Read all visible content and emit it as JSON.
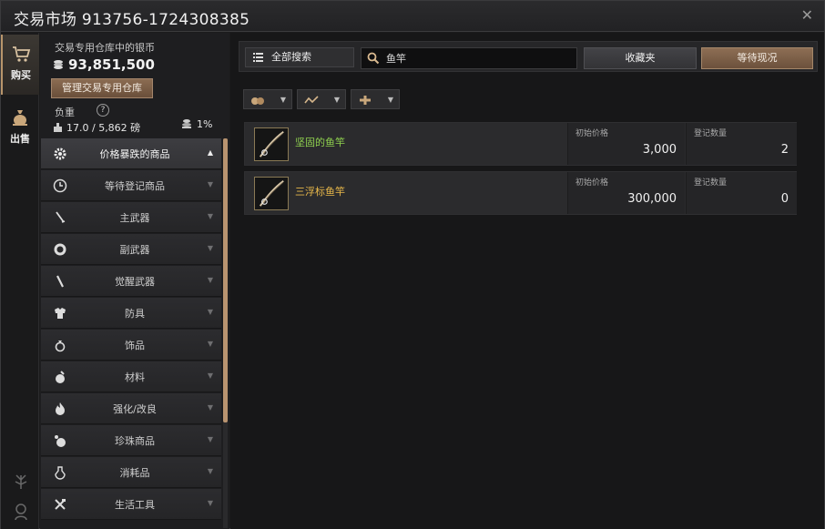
{
  "window": {
    "title": "交易市场 913756-1724308385"
  },
  "nav": {
    "buy_label": "购买",
    "sell_label": "出售"
  },
  "wallet": {
    "label": "交易专用仓库中的银币",
    "silver": "93,851,500",
    "manage_button": "管理交易专用仓库",
    "weight_label": "负重",
    "help": "?",
    "weight_value": "17.0 / 5,862 磅",
    "tax": "1%"
  },
  "categories": [
    {
      "label": "价格暴跌的商品",
      "icon": "gear-icon",
      "arrow": "▲",
      "active": true
    },
    {
      "label": "等待登记商品",
      "icon": "clock-icon",
      "arrow": "▼"
    },
    {
      "label": "主武器",
      "icon": "sword-icon",
      "arrow": "▼"
    },
    {
      "label": "副武器",
      "icon": "shield-icon",
      "arrow": "▼"
    },
    {
      "label": "觉醒武器",
      "icon": "awakening-sword-icon",
      "arrow": "▼"
    },
    {
      "label": "防具",
      "icon": "armor-icon",
      "arrow": "▼"
    },
    {
      "label": "饰品",
      "icon": "ring-icon",
      "arrow": "▼"
    },
    {
      "label": "材料",
      "icon": "material-icon",
      "arrow": "▼"
    },
    {
      "label": "强化/改良",
      "icon": "flame-icon",
      "arrow": "▼"
    },
    {
      "label": "珍珠商品",
      "icon": "pearl-icon",
      "arrow": "▼"
    },
    {
      "label": "消耗品",
      "icon": "potion-icon",
      "arrow": "▼"
    },
    {
      "label": "生活工具",
      "icon": "tools-icon",
      "arrow": "▼"
    }
  ],
  "search": {
    "all_search_label": "全部搜索",
    "query": "鱼竿",
    "favorites_button": "收藏夹",
    "waiting_button": "等待现况"
  },
  "results": {
    "price_header": "初始价格",
    "qty_header": "登记数量",
    "rows": [
      {
        "name": "坚固的鱼竿",
        "name_color": "#8fd14f",
        "price": "3,000",
        "qty": "2"
      },
      {
        "name": "三浮标鱼竿",
        "name_color": "#e8b84a",
        "price": "300,000",
        "qty": "0"
      }
    ]
  },
  "colors": {
    "accent": "#b8956b",
    "button_brown": "#7a5d46"
  }
}
